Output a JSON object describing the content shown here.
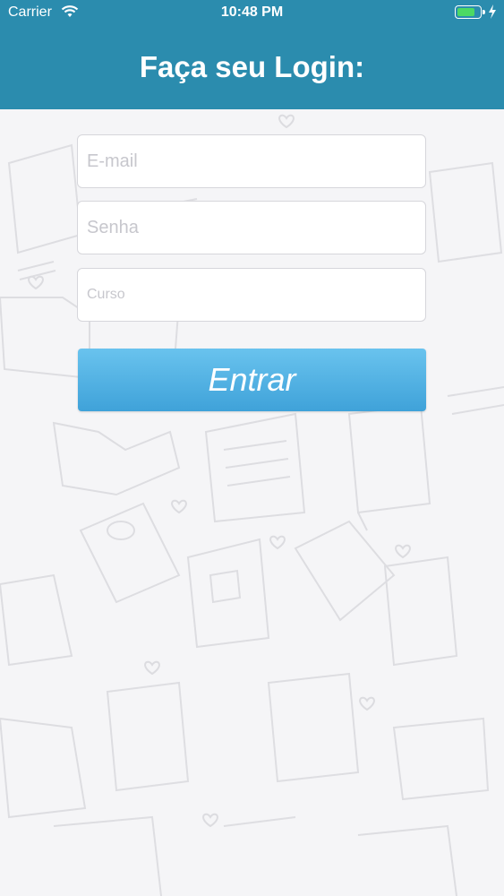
{
  "status_bar": {
    "carrier": "Carrier",
    "time": "10:48 PM",
    "battery_level": 0.8
  },
  "header": {
    "title": "Faça seu Login:"
  },
  "form": {
    "email_placeholder": "E-mail",
    "password_placeholder": "Senha",
    "course_placeholder": "Curso",
    "submit_label": "Entrar"
  },
  "colors": {
    "header_bg": "#2b8cae",
    "button_top": "#69c3ee",
    "button_bottom": "#3fa2d9",
    "background": "#f5f5f7"
  },
  "icons": [
    "wifi-icon",
    "battery-icon",
    "charging-bolt-icon"
  ]
}
